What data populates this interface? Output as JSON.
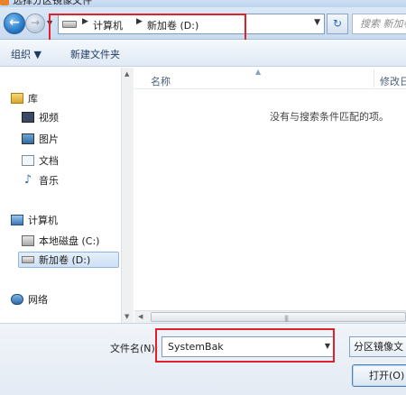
{
  "window": {
    "title": "选择分区镜像文件"
  },
  "address": {
    "segments": [
      "计算机",
      "新加卷 (D:)"
    ]
  },
  "search": {
    "placeholder": "搜索 新加卷 (D:)"
  },
  "toolbar": {
    "organize": "组织 ▼",
    "new_folder": "新建文件夹"
  },
  "navpane": {
    "library": "库",
    "video": "视频",
    "pictures": "图片",
    "documents": "文档",
    "music": "音乐",
    "computer": "计算机",
    "local_disk": "本地磁盘 (C:)",
    "new_volume": "新加卷 (D:)",
    "network": "网络"
  },
  "list": {
    "col_name": "名称",
    "col_modified": "修改日",
    "empty_message": "没有与搜索条件匹配的项。"
  },
  "bottom": {
    "filename_label": "文件名(N):",
    "filename_value": "SystemBak",
    "filter": "分区镜像文",
    "open_button": "打开(O)"
  },
  "colors": {
    "highlight": "#e0202a",
    "accent": "#1c6fc2"
  }
}
